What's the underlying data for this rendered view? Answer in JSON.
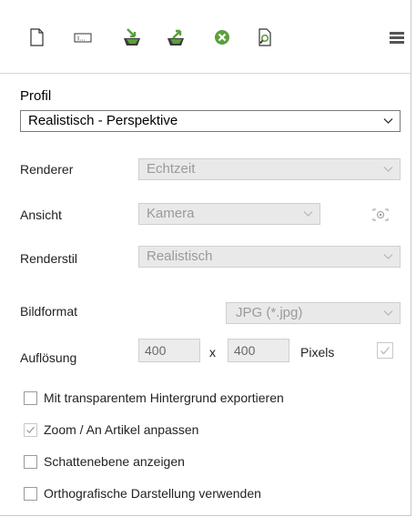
{
  "toolbar": {
    "icons": [
      "new-document-icon",
      "text-field-icon",
      "import-icon",
      "export-icon",
      "delete-icon",
      "preview-icon",
      "menu-icon"
    ]
  },
  "profil": {
    "label": "Profil",
    "value": "Realistisch - Perspektive"
  },
  "renderer": {
    "label": "Renderer",
    "value": "Echtzeit"
  },
  "ansicht": {
    "label": "Ansicht",
    "value": "Kamera"
  },
  "renderstil": {
    "label": "Renderstil",
    "value": "Realistisch"
  },
  "bildformat": {
    "label": "Bildformat",
    "value": "JPG (*.jpg)"
  },
  "aufloesung": {
    "label": "Auflösung",
    "width": "400",
    "separator": "x",
    "height": "400",
    "unit": "Pixels",
    "locked": true
  },
  "options": [
    {
      "label": "Mit transparentem Hintergrund exportieren",
      "checked": false
    },
    {
      "label": "Zoom / An Artikel anpassen",
      "checked": true
    },
    {
      "label": "Schattenebene anzeigen",
      "checked": false
    },
    {
      "label": "Orthografische Darstellung verwenden",
      "checked": false
    }
  ],
  "colors": {
    "accent_green": "#5aa03a",
    "disabled_bg": "#e9e9e9",
    "disabled_text": "#9a9a9a"
  }
}
